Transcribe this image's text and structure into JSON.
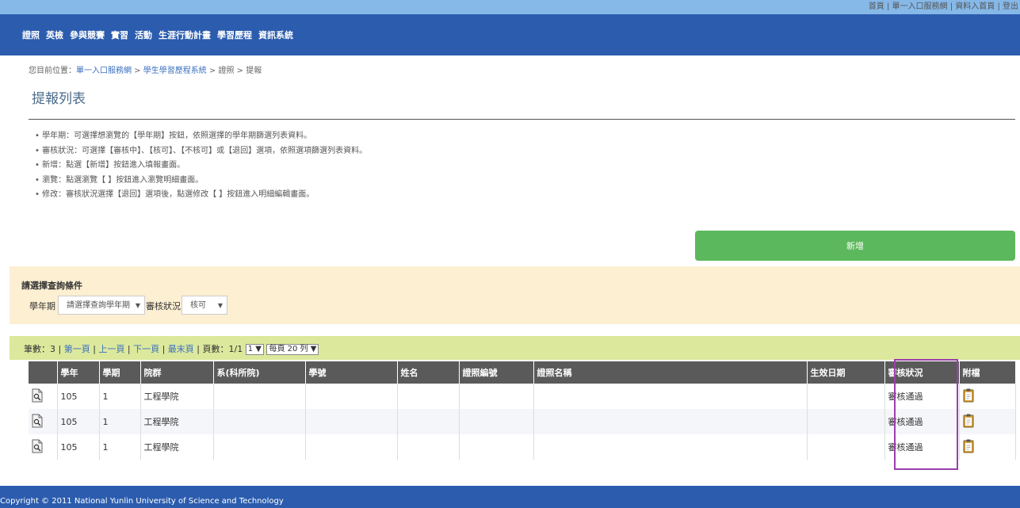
{
  "top_links": "首頁 | 單一入口服務網 | 資料入首頁 | 登出",
  "nav": [
    "證照",
    "英檢",
    "參與競賽",
    "實習",
    "活動",
    "生涯行動計畫",
    "學習歷程",
    "資訊系統"
  ],
  "breadcrumb": {
    "prefix": "您目前位置：",
    "items": [
      "單一入口服務網",
      "學生學習歷程系統",
      "證照",
      "提報"
    ],
    "sep": " > "
  },
  "page_title": "提報列表",
  "instructions": [
    "學年期：可選擇想瀏覽的【學年期】按鈕，依照選擇的學年期篩選列表資料。",
    "審核狀況：可選擇【審核中】、【核可】、【不核可】或【退回】選項，依照選項篩選列表資料。",
    "新增：點選【新增】按鈕進入填報畫面。",
    "瀏覽：點選瀏覽【 】按鈕進入瀏覽明細畫面。",
    "修改：審核狀況選擇【退回】選項後，點選修改【 】按鈕進入明細編輯畫面。"
  ],
  "add_button": "新增",
  "filter": {
    "title": "請選擇查詢條件",
    "term_label": "學年期",
    "term_value": "請選擇查詢學年期",
    "status_label": "審核狀況",
    "status_value": "核可"
  },
  "pager": {
    "count_label": "筆數：3",
    "first": "第一頁",
    "prev": "上一頁",
    "next": "下一頁",
    "last": "最末頁",
    "pages": "頁數：1/1",
    "page_select": "1",
    "per_page": "每頁 20 列"
  },
  "table": {
    "headers": [
      "",
      "學年",
      "學期",
      "院群",
      "系(科所院)",
      "學號",
      "姓名",
      "證照編號",
      "證照名稱",
      "生效日期",
      "審核狀況",
      "附檔"
    ],
    "rows": [
      [
        "105",
        "1",
        "工程學院",
        "",
        "",
        "",
        "",
        "",
        "",
        "審核通過"
      ],
      [
        "105",
        "1",
        "工程學院",
        "",
        "",
        "",
        "",
        "",
        "",
        "審核通過"
      ],
      [
        "105",
        "1",
        "工程學院",
        "",
        "",
        "",
        "",
        "",
        "",
        "審核通過"
      ]
    ]
  },
  "footer": "Copyright © 2011 National Yunlin University of Science and Technology"
}
